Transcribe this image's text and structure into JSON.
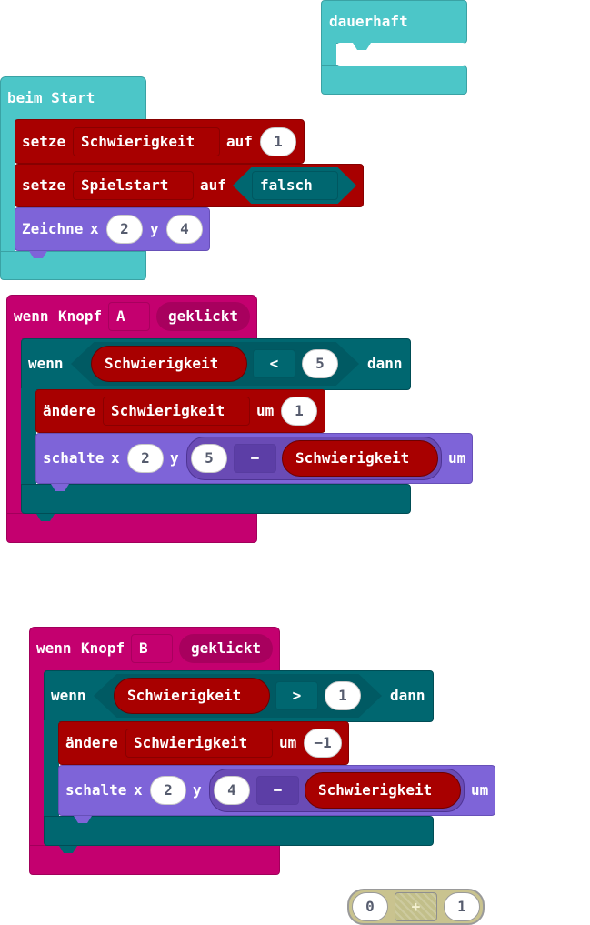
{
  "forever_block": {
    "label": "dauerhaft"
  },
  "on_start": {
    "label": "beim Start",
    "set1": {
      "kw_set": "setze",
      "var": "Schwierigkeit",
      "kw_to": "auf",
      "value": "1"
    },
    "set2": {
      "kw_set": "setze",
      "var": "Spielstart",
      "kw_to": "auf",
      "value": "falsch"
    },
    "plot": {
      "kw": "Zeichne",
      "kw_x": "x",
      "x": "2",
      "kw_y": "y",
      "y": "4"
    }
  },
  "button_a": {
    "kw_when": "wenn",
    "kw_button": "Knopf",
    "button": "A",
    "event": "geklickt",
    "if": {
      "kw_if": "wenn",
      "var": "Schwierigkeit",
      "op": "<",
      "value": "5",
      "kw_then": "dann"
    },
    "change": {
      "kw": "ändere",
      "var": "Schwierigkeit",
      "kw_by": "um",
      "value": "1"
    },
    "toggle": {
      "kw": "schalte",
      "kw_x": "x",
      "x": "2",
      "kw_y": "y",
      "left": "5",
      "op": "−",
      "var": "Schwierigkeit",
      "kw_end": "um"
    }
  },
  "button_b": {
    "kw_when": "wenn",
    "kw_button": "Knopf",
    "button": "B",
    "event": "geklickt",
    "if": {
      "kw_if": "wenn",
      "var": "Schwierigkeit",
      "op": ">",
      "value": "1",
      "kw_then": "dann"
    },
    "change": {
      "kw": "ändere",
      "var": "Schwierigkeit",
      "kw_by": "um",
      "value": "−1"
    },
    "toggle": {
      "kw": "schalte",
      "kw_x": "x",
      "x": "2",
      "kw_y": "y",
      "left": "4",
      "op": "−",
      "var": "Schwierigkeit",
      "kw_end": "um"
    }
  },
  "loose_add": {
    "left": "0",
    "op": "+",
    "right": "1"
  },
  "colors": {
    "basic": "#4cc6c8",
    "variables": "#a80000",
    "led": "#7e64d8",
    "input": "#c4006f",
    "logic": "#006770",
    "math": "#6a4bb5"
  }
}
